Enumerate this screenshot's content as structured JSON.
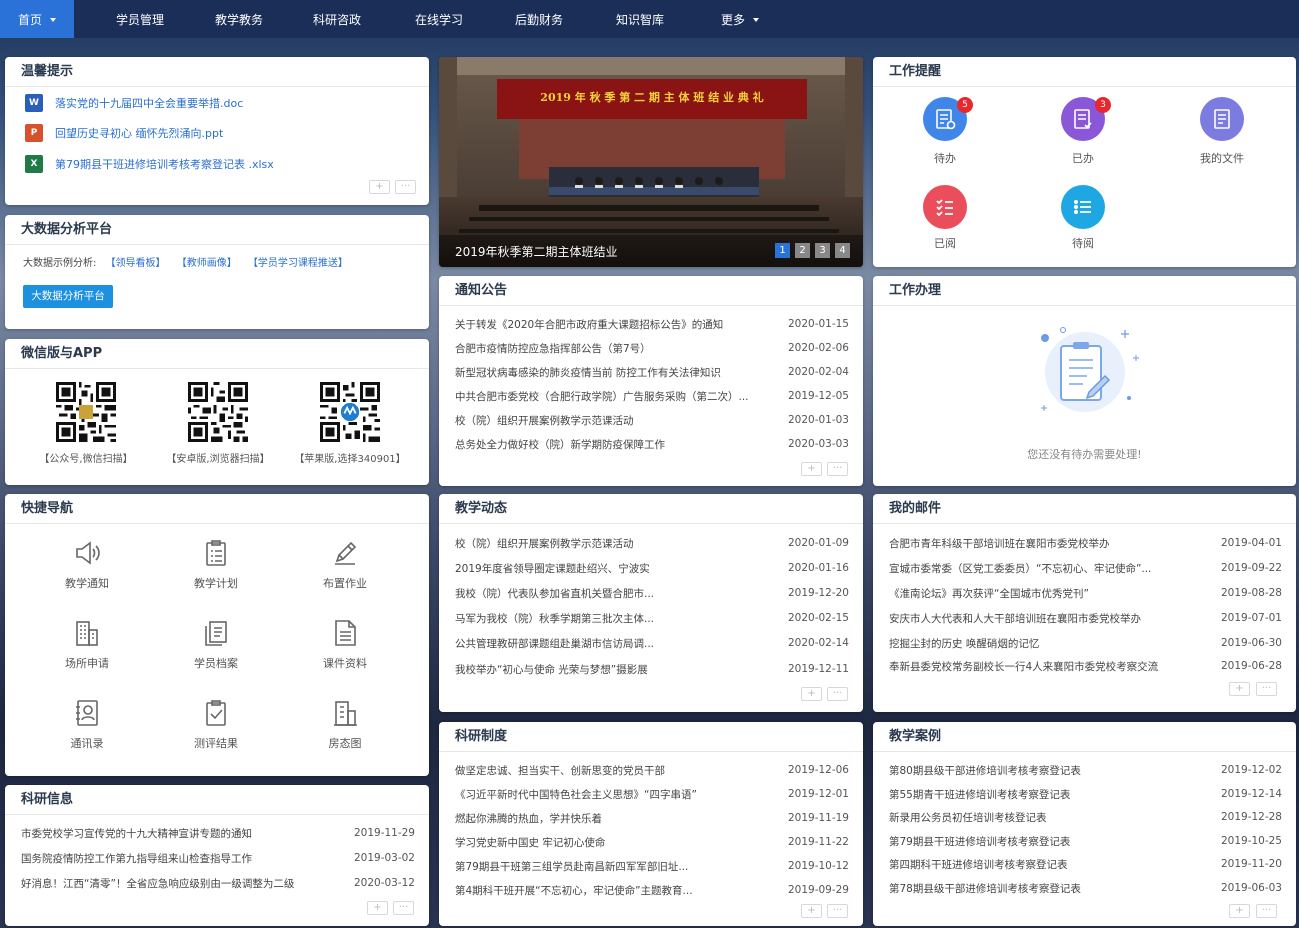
{
  "nav": {
    "items": [
      {
        "label": "首页"
      },
      {
        "label": "学员管理"
      },
      {
        "label": "教学教务"
      },
      {
        "label": "科研咨政"
      },
      {
        "label": "在线学习"
      },
      {
        "label": "后勤财务"
      },
      {
        "label": "知识智库"
      },
      {
        "label": "更多"
      }
    ]
  },
  "tips": {
    "title": "温馨提示",
    "files": [
      {
        "type": "word",
        "badge": "W",
        "name": "落实党的十九届四中全会重要举措.doc",
        "color": "#2b5eb8"
      },
      {
        "type": "ppt",
        "badge": "P",
        "name": "回望历史寻初心  缅怀先烈涌向.ppt",
        "color": "#d6512c"
      },
      {
        "type": "excel",
        "badge": "X",
        "name": "第79期县干班进修培训考核考察登记表 .xlsx",
        "color": "#1f7a45"
      }
    ]
  },
  "bigdata": {
    "title": "大数据分析平台",
    "examples_label": "大数据示例分析:",
    "links": [
      "【领导看板】",
      "【教师画像】",
      "【学员学习课程推送】"
    ],
    "button": "大数据分析平台"
  },
  "app": {
    "title": "微信版与APP",
    "qrs": [
      {
        "caption": "【公众号,微信扫描】"
      },
      {
        "caption": "【安卓版,浏览器扫描】"
      },
      {
        "caption": "【苹果版,选择340901】"
      }
    ]
  },
  "quicknav": {
    "title": "快捷导航",
    "items": [
      {
        "label": "教学通知",
        "icon": "speaker-icon"
      },
      {
        "label": "教学计划",
        "icon": "clipboard-list-icon"
      },
      {
        "label": "布置作业",
        "icon": "pencil-icon"
      },
      {
        "label": "场所申请",
        "icon": "building-icon"
      },
      {
        "label": "学员档案",
        "icon": "documents-icon"
      },
      {
        "label": "课件资料",
        "icon": "file-text-icon"
      },
      {
        "label": "通讯录",
        "icon": "contact-card-icon"
      },
      {
        "label": "测评结果",
        "icon": "clipboard-check-icon"
      },
      {
        "label": "房态图",
        "icon": "floorplan-icon"
      }
    ]
  },
  "research_info": {
    "title": "科研信息",
    "items": [
      {
        "title": "市委党校学习宣传党的十九大精神宣讲专题的通知",
        "date": "2019-11-29"
      },
      {
        "title": "国务院疫情防控工作第九指导组来山检查指导工作",
        "date": "2019-03-02"
      },
      {
        "title": "好消息！江西“清零”！全省应急响应级别由一级调整为二级",
        "date": "2020-03-12"
      }
    ]
  },
  "banner": {
    "caption": "2019年秋季第二期主体班结业",
    "banner_text": "2019 年 秋 季 第 二 期 主 体 班 结 业 典 礼",
    "pages": [
      "1",
      "2",
      "3",
      "4"
    ]
  },
  "notices": {
    "title": "通知公告",
    "items": [
      {
        "title": "关于转发《2020年合肥市政府重大课题招标公告》的通知",
        "date": "2020-01-15"
      },
      {
        "title": "合肥市疫情防控应急指挥部公告（第7号）",
        "date": "2020-02-06"
      },
      {
        "title": "新型冠状病毒感染的肺炎疫情当前 防控工作有关法律知识",
        "date": "2020-02-04"
      },
      {
        "title": "中共合肥市委党校（合肥行政学院）广告服务采购（第二次）...",
        "date": "2019-12-05"
      },
      {
        "title": "校（院）组织开展案例教学示范课活动",
        "date": "2020-01-03"
      },
      {
        "title": "总务处全力做好校（院）新学期防疫保障工作",
        "date": "2020-03-03"
      }
    ]
  },
  "teaching_news": {
    "title": "教学动态",
    "items": [
      {
        "title": "校（院）组织开展案例教学示范课活动",
        "date": "2020-01-09"
      },
      {
        "title": "2019年度省领导圈定课题赴绍兴、宁波实",
        "date": "2020-01-16"
      },
      {
        "title": "我校（院）代表队参加省直机关暨合肥市...",
        "date": "2019-12-20"
      },
      {
        "title": "马军为我校（院）秋季学期第三批次主体...",
        "date": "2020-02-15"
      },
      {
        "title": "公共管理教研部课题组赴巢湖市信访局调...",
        "date": "2020-02-14"
      },
      {
        "title": "我校举办“初心与使命 光荣与梦想”摄影展",
        "date": "2019-12-11"
      }
    ]
  },
  "research_rules": {
    "title": "科研制度",
    "items": [
      {
        "title": "做坚定忠诚、担当实干、创新思变的党员干部",
        "date": "2019-12-06"
      },
      {
        "title": "《习近平新时代中国特色社会主义思想》“四字串语”",
        "date": "2019-12-01"
      },
      {
        "title": "燃起你沸腾的热血，学并快乐着",
        "date": "2019-11-19"
      },
      {
        "title": "学习党史新中国史 牢记初心使命",
        "date": "2019-11-22"
      },
      {
        "title": "第79期县干班第三组学员赴南昌新四军军部旧址...",
        "date": "2019-10-12"
      },
      {
        "title": "第4期科干班开展“不忘初心，牢记使命”主题教育...",
        "date": "2019-09-29"
      }
    ]
  },
  "reminders": {
    "title": "工作提醒",
    "items": [
      {
        "label": "待办",
        "badge": "5",
        "color": "#3f86e8",
        "icon": "todo-icon"
      },
      {
        "label": "已办",
        "badge": "3",
        "color": "#8a57d8",
        "icon": "done-icon"
      },
      {
        "label": "我的文件",
        "badge": "",
        "color": "#7b7be0",
        "icon": "my-files-icon"
      },
      {
        "label": "已阅",
        "badge": "",
        "color": "#ea4e5a",
        "icon": "read-icon"
      },
      {
        "label": "待阅",
        "badge": "",
        "color": "#1ea7e2",
        "icon": "to-read-icon"
      }
    ]
  },
  "work": {
    "title": "工作办理",
    "empty": "您还没有待办需要处理!"
  },
  "mail": {
    "title": "我的邮件",
    "items": [
      {
        "title": "合肥市青年科级干部培训班在襄阳市委党校举办",
        "date": "2019-04-01"
      },
      {
        "title": "宣城市委常委（区党工委委员）“不忘初心、牢记使命”...",
        "date": "2019-09-22"
      },
      {
        "title": "《淮南论坛》再次获评“全国城市优秀党刊”",
        "date": "2019-08-28"
      },
      {
        "title": "安庆市人大代表和人大干部培训班在襄阳市委党校举办",
        "date": "2019-07-01"
      },
      {
        "title": "挖掘尘封的历史 唤醒硝烟的记忆",
        "date": "2019-06-30"
      },
      {
        "title": "奉新县委党校常务副校长一行4人来襄阳市委党校考察交流",
        "date": "2019-06-28"
      }
    ]
  },
  "cases": {
    "title": "教学案例",
    "items": [
      {
        "title": "第80期县级干部进修培训考核考察登记表",
        "date": "2019-12-02"
      },
      {
        "title": "第55期青干班进修培训考核考察登记表",
        "date": "2019-12-14"
      },
      {
        "title": "新录用公务员初任培训考核登记表",
        "date": "2019-12-28"
      },
      {
        "title": "第79期县干班进修培训考核考察登记表",
        "date": "2019-10-25"
      },
      {
        "title": "第四期科干班进修培训考核考察登记表",
        "date": "2019-11-20"
      },
      {
        "title": "第78期县级干部进修培训考核考察登记表",
        "date": "2019-06-03"
      }
    ]
  },
  "controls": {
    "add": "+",
    "more": "···"
  }
}
